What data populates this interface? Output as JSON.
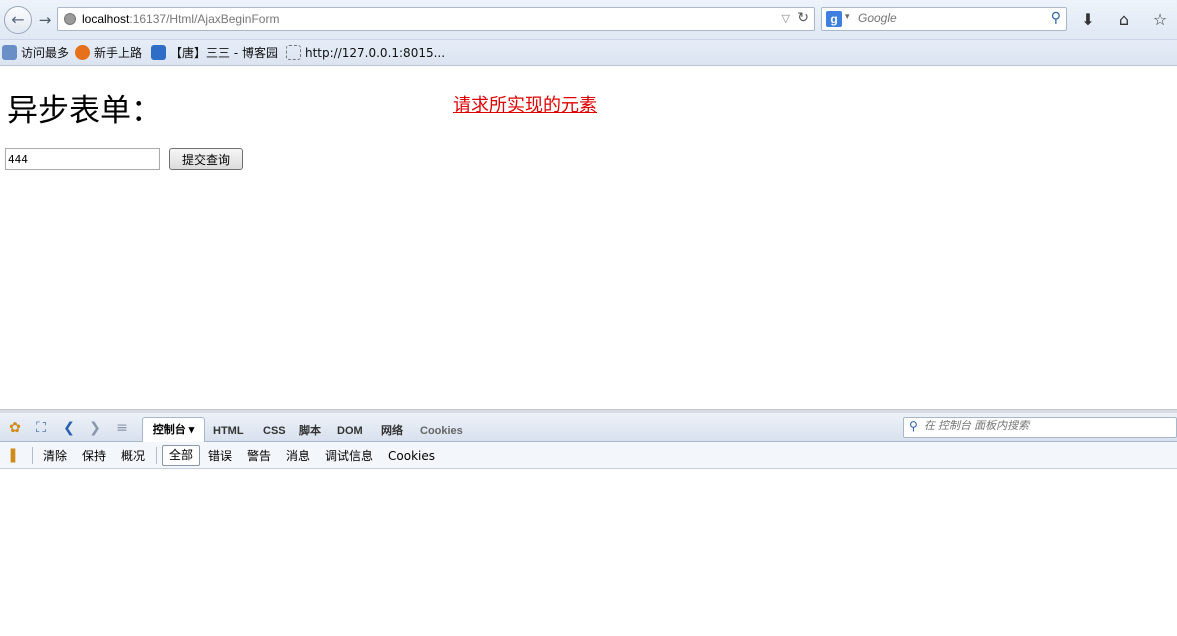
{
  "browser": {
    "url_host": "localhost",
    "url_path": ":16137/Html/AjaxBeginForm",
    "search_placeholder": "Google",
    "search_engine": "g"
  },
  "bookmarks": [
    {
      "label": "访问最多"
    },
    {
      "label": "新手上路"
    },
    {
      "label": "【唐】三三 - 博客园"
    },
    {
      "label": "http://127.0.0.1:8015..."
    }
  ],
  "page": {
    "title": "异步表单：",
    "result_link": "请求所实现的元素",
    "input_value": "444",
    "submit_label": "提交查询"
  },
  "firebug": {
    "tabs": {
      "console": "控制台 ▾",
      "html": "HTML",
      "css": "CSS",
      "script": "脚本",
      "dom": "DOM",
      "net": "网络",
      "cookies": "Cookies"
    },
    "search_placeholder": "在 控制台 面板内搜索",
    "subtoolbar": {
      "clear": "清除",
      "persist": "保持",
      "profile": "概况",
      "all": "全部",
      "errors": "错误",
      "warnings": "警告",
      "info": "消息",
      "debug": "调试信息",
      "cookies": "Cookies"
    }
  },
  "colors": {
    "link_red": "#e00000",
    "chrome_blue": "#dfe8f4"
  }
}
